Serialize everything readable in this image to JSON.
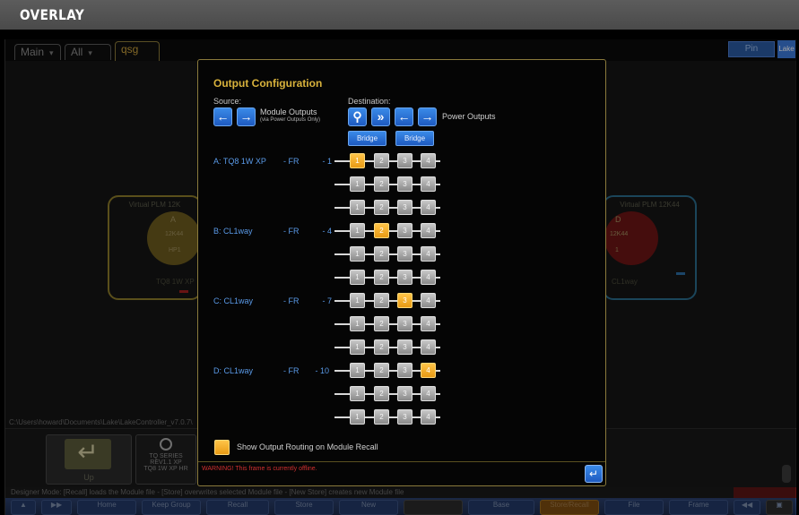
{
  "banner": {
    "title": "OVERLAY"
  },
  "tabs": [
    {
      "label": "Main"
    },
    {
      "label": "All"
    },
    {
      "label": "qsg"
    }
  ],
  "header_right": {
    "pin_label": "Pin",
    "logo_text": "Lake"
  },
  "modules_bg": {
    "a": {
      "title": "Virtual PLM 12K",
      "letter": "A",
      "model": "12K44",
      "sub": "HP1",
      "name": "TQ8 1W XP"
    },
    "d": {
      "title": "Virtual PLM 12K44",
      "letter": "D",
      "model": "12K44",
      "sub": "1",
      "name": "CL1way"
    }
  },
  "path_text": "C:\\Users\\howard\\Documents\\Lake\\LakeController_v7.0.7\\",
  "up_tile": {
    "label": "Up"
  },
  "tq_tile": {
    "line1": "TQ SERIES",
    "line2": "REV1.1 XP",
    "line3": "TQ8 1W XP HR"
  },
  "status_line": "Designer Mode: [Recall] loads the Module file - [Store] overwrites selected Module file - [New Store] creates new Module file",
  "toolbar": {
    "home": "Home",
    "keep_group": "Keep Group",
    "recall": "Recall",
    "store": "Store",
    "new": "New",
    "base": "Base",
    "store_recall": "Store/Recall",
    "file": "File",
    "frame": "Frame"
  },
  "dialog": {
    "title": "Output Configuration",
    "source_label": "Source:",
    "destination_label": "Destination:",
    "module_outputs": "Module Outputs",
    "module_outputs_sub": "(via Power Outputs Only)",
    "power_outputs": "Power Outputs",
    "bridge_1": "Bridge",
    "bridge_2": "Bridge",
    "rows": [
      {
        "label": "A: TQ8 1W XP",
        "fr": "- FR",
        "num": "- 1"
      },
      {
        "label": "B: CL1way",
        "fr": "- FR",
        "num": "- 4"
      },
      {
        "label": "C: CL1way",
        "fr": "- FR",
        "num": "- 7"
      },
      {
        "label": "D: CL1way",
        "fr": "- FR",
        "num": "- 10"
      }
    ],
    "chip_labels": [
      "1",
      "2",
      "3",
      "4"
    ],
    "active_chips": [
      [
        0,
        0
      ],
      [
        3,
        1
      ],
      [
        6,
        2
      ],
      [
        9,
        3
      ]
    ],
    "recall_label": "Show Output Routing on Module Recall",
    "warning": "WARNING! This frame is currently offline."
  },
  "colors": {
    "accent_gold": "#d8b23c",
    "chip_on": "#f0a820",
    "label_blue": "#5a9ae8",
    "button_blue": "#2a72d8",
    "warning_red": "#d03030"
  }
}
